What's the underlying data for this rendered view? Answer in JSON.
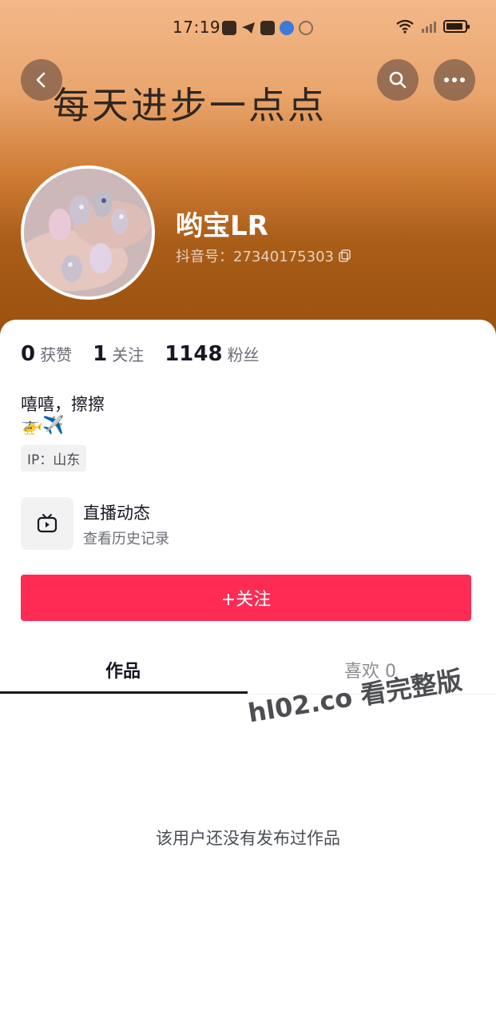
{
  "status_bar": {
    "time": "17:19"
  },
  "header": {
    "banner_text": "每天进步一点点",
    "username": "哟宝LR",
    "douyin_id": "抖音号：27340175303"
  },
  "stats": [
    {
      "num": "0",
      "label": "获赞"
    },
    {
      "num": "1",
      "label": "关注"
    },
    {
      "num": "1148",
      "label": "粉丝"
    }
  ],
  "bio": {
    "text": "嘻嘻，擦擦",
    "emoji": "🚁✈️",
    "ip": "IP：山东"
  },
  "live": {
    "title": "直播动态",
    "subtitle": "查看历史记录"
  },
  "follow_button": "+关注",
  "tabs": [
    {
      "label": "作品",
      "active": true
    },
    {
      "label": "喜欢 0",
      "active": false
    }
  ],
  "watermark": "hl02.co 看完整版",
  "empty_message": "该用户还没有发布过作品",
  "colors": {
    "accent": "#fe2c55",
    "text": "#161823"
  }
}
